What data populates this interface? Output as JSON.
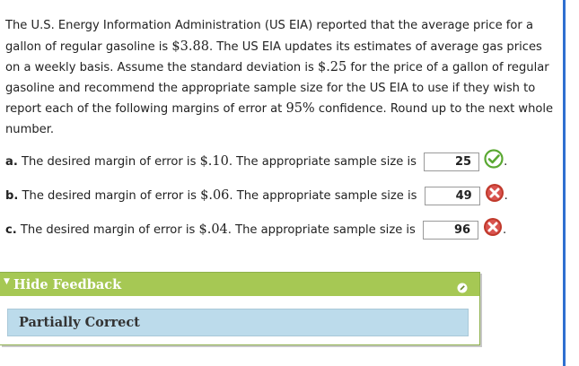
{
  "question": {
    "intro_parts": [
      "The U.S. Energy Information Administration (US EIA) reported that the average price for a gallon of regular gasoline is ",
      "$3.88",
      ". The US EIA updates its estimates of average gas prices on a weekly basis. Assume the standard deviation is ",
      "$.25",
      " for the price of a gallon of regular gasoline and recommend the appropriate sample size for the US EIA to use if they wish to report each of the following margins of error at ",
      "95%",
      " confidence. Round up to the next whole number."
    ]
  },
  "items": [
    {
      "letter": "a.",
      "prefix": " The desired margin of error is ",
      "margin": "$.10",
      "suffix": ". The appropriate sample size is",
      "answer": "25",
      "status": "correct"
    },
    {
      "letter": "b.",
      "prefix": " The desired margin of error is ",
      "margin": "$.06",
      "suffix": ". The appropriate sample size is",
      "answer": "49",
      "status": "incorrect"
    },
    {
      "letter": "c.",
      "prefix": " The desired margin of error is ",
      "margin": "$.04",
      "suffix": ". The appropriate sample size is",
      "answer": "96",
      "status": "incorrect"
    }
  ],
  "trailing_period": ".",
  "feedback": {
    "toggle_icon": "triangle-down-icon",
    "title": "Hide Feedback",
    "status": "Partially Correct"
  },
  "colors": {
    "feedback_header": "#a6c854",
    "feedback_body": "#bcdbeb",
    "correct": "#5aa832",
    "incorrect": "#c0392b",
    "side_bar": "#2f6fd0"
  }
}
